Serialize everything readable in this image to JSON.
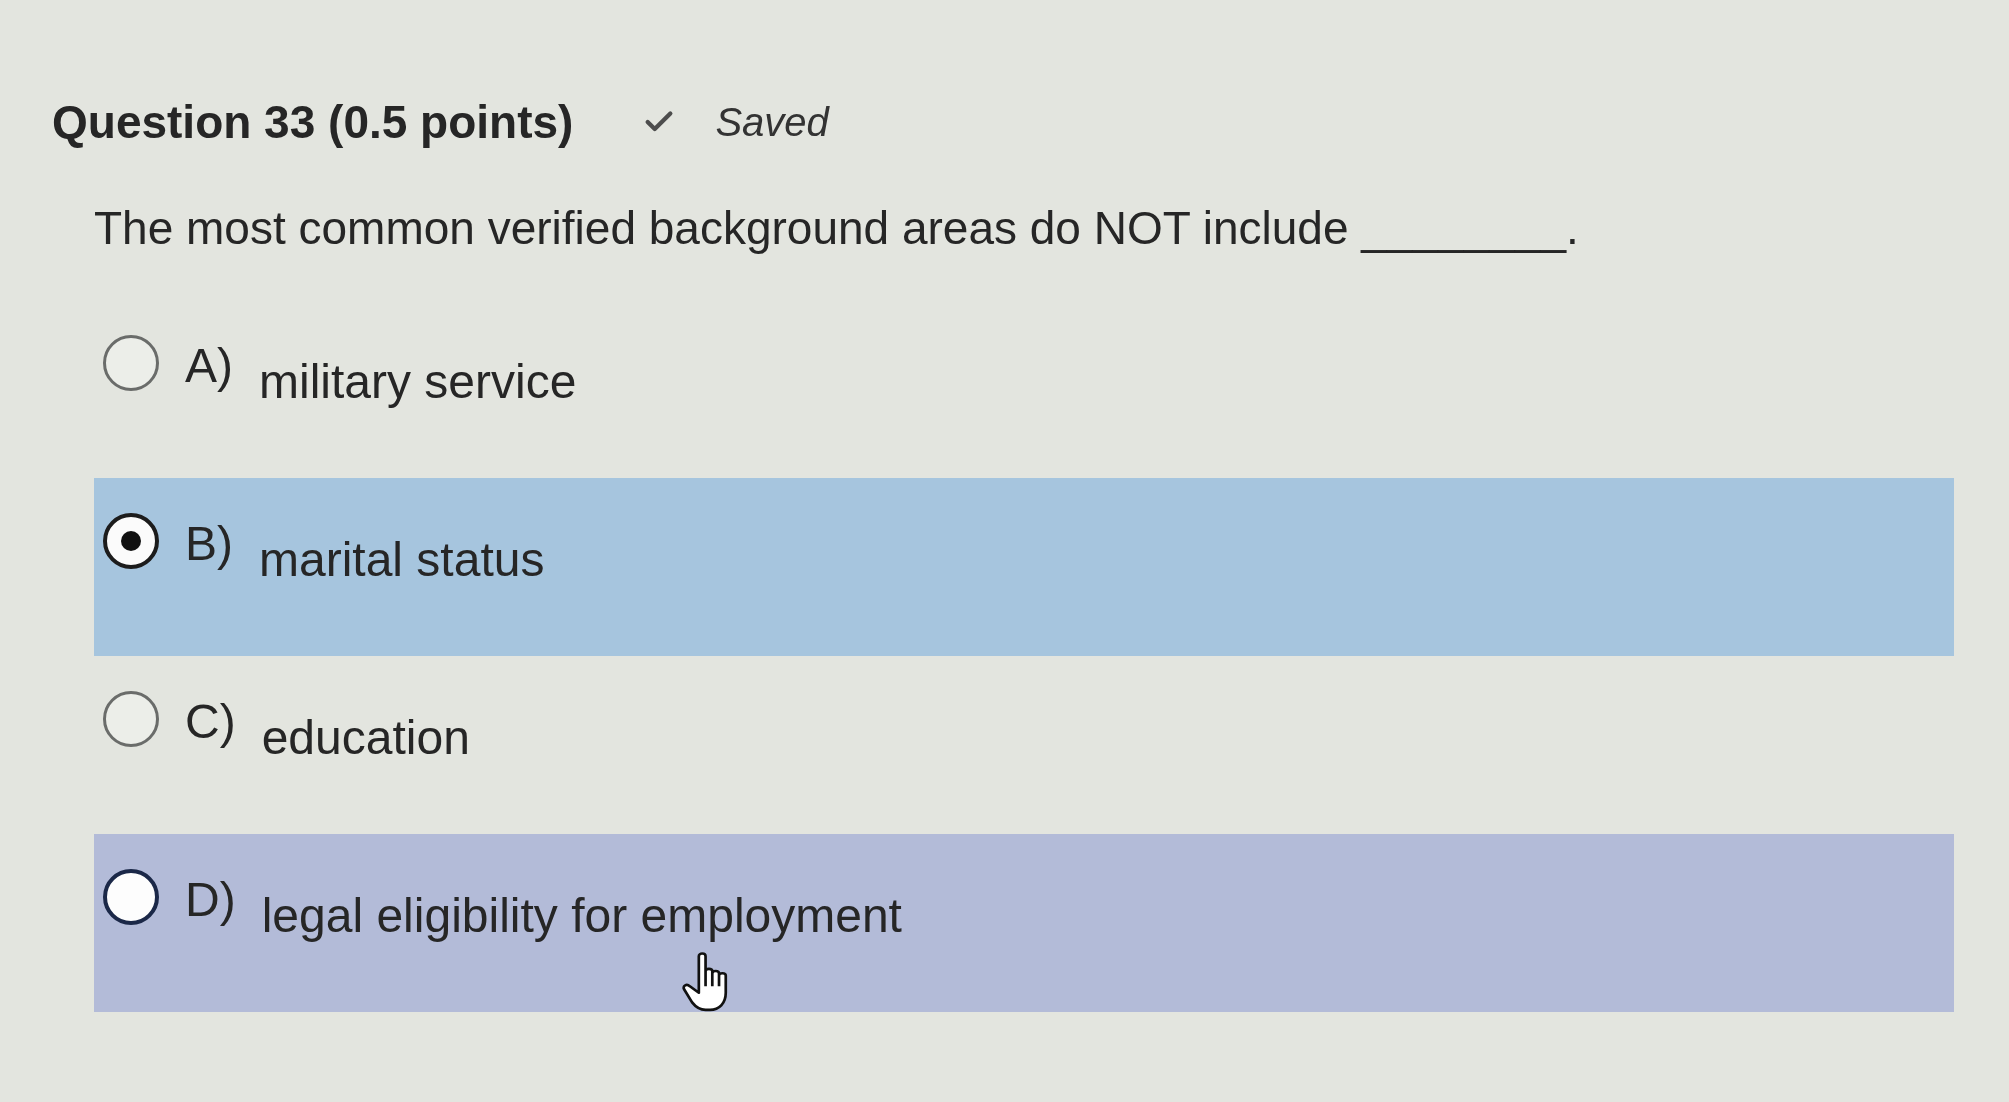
{
  "question": {
    "title": "Question 33 (0.5 points)",
    "status": {
      "saved": true,
      "label": "Saved"
    },
    "stem": "The most common verified background areas do NOT include ________."
  },
  "options": [
    {
      "letter": "A)",
      "text": "military service",
      "selected": false,
      "hovered": false
    },
    {
      "letter": "B)",
      "text": "marital status",
      "selected": true,
      "hovered": false
    },
    {
      "letter": "C)",
      "text": "education",
      "selected": false,
      "hovered": false
    },
    {
      "letter": "D)",
      "text": "legal eligibility for employment",
      "selected": false,
      "hovered": true
    }
  ]
}
